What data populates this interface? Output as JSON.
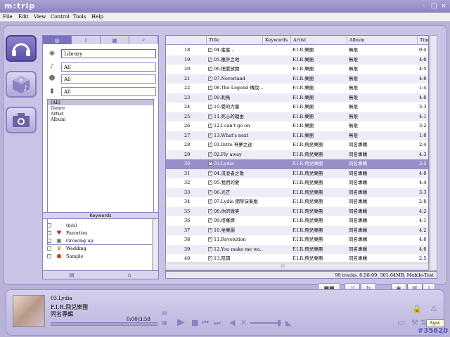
{
  "app": {
    "title": "m:trip"
  },
  "menu": [
    "File",
    "Edit",
    "View",
    "Control",
    "Tools",
    "Help"
  ],
  "filters": {
    "source": "Library",
    "f2": "All",
    "f3": "All",
    "f4": "All"
  },
  "categories": [
    "(All)",
    "Genre",
    "Artist",
    "Album"
  ],
  "keywords": {
    "header": "Keywords",
    "items": [
      "(n/a)",
      "Favorites",
      "Growing up",
      "Wedding",
      "Sample"
    ]
  },
  "columns": [
    "Title",
    "Keywords",
    "Artist",
    "Album",
    "Time"
  ],
  "tracks": [
    {
      "num": "18",
      "title": "04.蜜蜜...",
      "artist": "F.I.R.樂團",
      "album": "無限",
      "time": "0:4"
    },
    {
      "num": "19",
      "title": "05.應許之地",
      "artist": "F.I.R.樂團",
      "album": "無限",
      "time": "4:0"
    },
    {
      "num": "20",
      "title": "06.把愛放開",
      "artist": "F.I.R.樂團",
      "album": "無限",
      "time": "4:5"
    },
    {
      "num": "21",
      "title": "07.Neverland",
      "artist": "F.I.R.樂團",
      "album": "無限",
      "time": "4:0"
    },
    {
      "num": "22",
      "title": "08.The Legend 傳說...",
      "artist": "F.I.R.樂團",
      "album": "無限",
      "time": "1:4"
    },
    {
      "num": "23",
      "title": "09.刺鳥",
      "artist": "F.I.R.樂團",
      "album": "無限",
      "time": "4:0"
    },
    {
      "num": "24",
      "title": "10.愛的力量",
      "artist": "F.I.R.樂團",
      "album": "無限",
      "time": "3:3"
    },
    {
      "num": "25",
      "title": "11.死心的理由",
      "artist": "F.I.R.樂團",
      "album": "無限",
      "time": "4:1"
    },
    {
      "num": "26",
      "title": "12.I can't go on",
      "artist": "F.I.R.樂團",
      "album": "無限",
      "time": "3:2"
    },
    {
      "num": "27",
      "title": "13.What's next",
      "artist": "F.I.R.樂團",
      "album": "無限",
      "time": "1:0"
    },
    {
      "num": "28",
      "title": "01.Intro 神夢之途",
      "artist": "F.I.R.飛兒樂團",
      "album": "同名專輯",
      "time": "2:4"
    },
    {
      "num": "29",
      "title": "02.Fly away",
      "artist": "F.I.R.飛兒樂團",
      "album": "同名專輯",
      "time": "4:3"
    },
    {
      "num": "30",
      "title": "03.Lydia",
      "artist": "F.I.R.飛兒樂團",
      "album": "同名專輯",
      "time": "3:5"
    },
    {
      "num": "31",
      "title": "04.流浪者之歌",
      "artist": "F.I.R.飛兒樂團",
      "album": "同名專輯",
      "time": "4:0"
    },
    {
      "num": "32",
      "title": "05.我們的愛",
      "artist": "F.I.R.飛兒樂團",
      "album": "同名專輯",
      "time": "4:4"
    },
    {
      "num": "33",
      "title": "06.光芒",
      "artist": "F.I.R.飛兒樂團",
      "album": "同名專輯",
      "time": "3:3"
    },
    {
      "num": "34",
      "title": "07.Lydia 鋼琴演奏版",
      "artist": "F.I.R.飛兒樂團",
      "album": "同名專輯",
      "time": "2:0"
    },
    {
      "num": "35",
      "title": "08.你的微笑",
      "artist": "F.I.R.飛兒樂團",
      "album": "同名專輯",
      "time": "4:2"
    },
    {
      "num": "36",
      "title": "09.塔羅牌",
      "artist": "F.I.R.飛兒樂團",
      "album": "同名專輯",
      "time": "4:1"
    },
    {
      "num": "37",
      "title": "10.坐樂園",
      "artist": "F.I.R.飛兒樂團",
      "album": "同名專輯",
      "time": "4:2"
    },
    {
      "num": "38",
      "title": "11.Revolution",
      "artist": "F.I.R.飛兒樂團",
      "album": "同名專輯",
      "time": "4:0"
    },
    {
      "num": "39",
      "title": "12.You make me wa...",
      "artist": "F.I.R.飛兒樂團",
      "album": "同名專輯",
      "time": "4:0"
    },
    {
      "num": "40",
      "title": "13.陪讀",
      "artist": "F.I.R.飛兒樂團",
      "album": "同名專輯",
      "time": "2:5"
    }
  ],
  "selected_track_number": "30",
  "status": "99 tracks, 6:58:09, 501.64MB, Mobile-Test",
  "now_playing": {
    "title": "03.Lydia",
    "artist": "F.I.R.飛兒樂團",
    "album": "同名專輯",
    "time": "0:00/3:58",
    "progress": 0
  },
  "tooltip": "Sync",
  "badge": "#35620"
}
